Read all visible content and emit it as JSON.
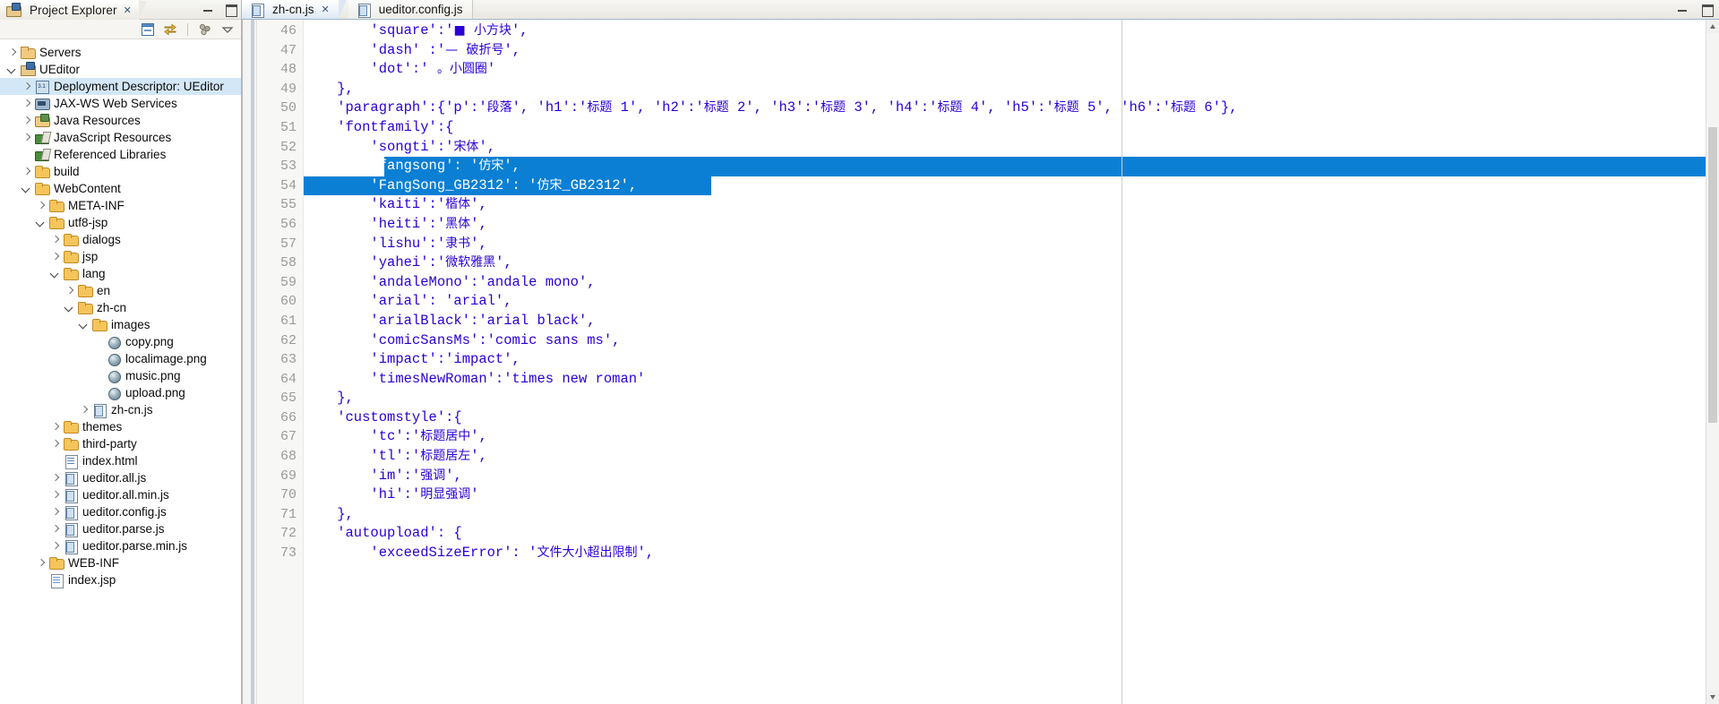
{
  "window": {
    "minimize_label": "Minimize",
    "maximize_label": "Maximize"
  },
  "project_explorer": {
    "tab_title": "Project Explorer",
    "tab_close": "✕",
    "toolbar": [
      {
        "name": "collapse-all-icon",
        "label": "Collapse All"
      },
      {
        "name": "link-with-editor-icon",
        "label": "Link with Editor"
      },
      {
        "name": "view-menu-icon",
        "label": "View Menu"
      },
      {
        "name": "minimize-view-icon",
        "label": "Minimize"
      }
    ],
    "tree": [
      {
        "label": "Servers",
        "indent": 0,
        "twisty": "closed",
        "icon": "ic-server",
        "selected": false
      },
      {
        "label": "UEditor",
        "indent": 0,
        "twisty": "open",
        "icon": "ic-project",
        "selected": false
      },
      {
        "label": "Deployment Descriptor: UEditor",
        "indent": 1,
        "twisty": "closed",
        "icon": "ic-dd",
        "selected": true
      },
      {
        "label": "JAX-WS Web Services",
        "indent": 1,
        "twisty": "closed",
        "icon": "ic-jax",
        "selected": false
      },
      {
        "label": "Java Resources",
        "indent": 1,
        "twisty": "closed",
        "icon": "ic-java",
        "selected": false
      },
      {
        "label": "JavaScript Resources",
        "indent": 1,
        "twisty": "closed",
        "icon": "ic-jslib",
        "selected": false
      },
      {
        "label": "Referenced Libraries",
        "indent": 1,
        "twisty": "none",
        "icon": "ic-jslib",
        "selected": false
      },
      {
        "label": "build",
        "indent": 1,
        "twisty": "closed",
        "icon": "ic-folder",
        "selected": false
      },
      {
        "label": "WebContent",
        "indent": 1,
        "twisty": "open",
        "icon": "ic-folder",
        "selected": false
      },
      {
        "label": "META-INF",
        "indent": 2,
        "twisty": "closed",
        "icon": "ic-folder",
        "selected": false
      },
      {
        "label": "utf8-jsp",
        "indent": 2,
        "twisty": "open",
        "icon": "ic-folder",
        "selected": false
      },
      {
        "label": "dialogs",
        "indent": 3,
        "twisty": "closed",
        "icon": "ic-folder",
        "selected": false
      },
      {
        "label": "jsp",
        "indent": 3,
        "twisty": "closed",
        "icon": "ic-folder",
        "selected": false
      },
      {
        "label": "lang",
        "indent": 3,
        "twisty": "open",
        "icon": "ic-folder",
        "selected": false
      },
      {
        "label": "en",
        "indent": 4,
        "twisty": "closed",
        "icon": "ic-folder",
        "selected": false
      },
      {
        "label": "zh-cn",
        "indent": 4,
        "twisty": "open",
        "icon": "ic-folder",
        "selected": false
      },
      {
        "label": "images",
        "indent": 5,
        "twisty": "open",
        "icon": "ic-folder",
        "selected": false
      },
      {
        "label": "copy.png",
        "indent": 6,
        "twisty": "none",
        "icon": "ic-png",
        "selected": false
      },
      {
        "label": "localimage.png",
        "indent": 6,
        "twisty": "none",
        "icon": "ic-png",
        "selected": false
      },
      {
        "label": "music.png",
        "indent": 6,
        "twisty": "none",
        "icon": "ic-png",
        "selected": false
      },
      {
        "label": "upload.png",
        "indent": 6,
        "twisty": "none",
        "icon": "ic-png",
        "selected": false
      },
      {
        "label": "zh-cn.js",
        "indent": 5,
        "twisty": "closed",
        "icon": "ic-js",
        "selected": false
      },
      {
        "label": "themes",
        "indent": 3,
        "twisty": "closed",
        "icon": "ic-folder",
        "selected": false
      },
      {
        "label": "third-party",
        "indent": 3,
        "twisty": "closed",
        "icon": "ic-folder",
        "selected": false
      },
      {
        "label": "index.html",
        "indent": 3,
        "twisty": "none",
        "icon": "ic-html",
        "selected": false
      },
      {
        "label": "ueditor.all.js",
        "indent": 3,
        "twisty": "closed",
        "icon": "ic-js",
        "selected": false
      },
      {
        "label": "ueditor.all.min.js",
        "indent": 3,
        "twisty": "closed",
        "icon": "ic-js",
        "selected": false
      },
      {
        "label": "ueditor.config.js",
        "indent": 3,
        "twisty": "closed",
        "icon": "ic-js",
        "selected": false
      },
      {
        "label": "ueditor.parse.js",
        "indent": 3,
        "twisty": "closed",
        "icon": "ic-js",
        "selected": false
      },
      {
        "label": "ueditor.parse.min.js",
        "indent": 3,
        "twisty": "closed",
        "icon": "ic-js",
        "selected": false
      },
      {
        "label": "WEB-INF",
        "indent": 2,
        "twisty": "closed",
        "icon": "ic-folder",
        "selected": false
      },
      {
        "label": "index.jsp",
        "indent": 2,
        "twisty": "none",
        "icon": "ic-jsp",
        "selected": false
      }
    ]
  },
  "editor": {
    "tabs": [
      {
        "label": "zh-cn.js",
        "active": true,
        "icon": "js-file-icon",
        "close": "✕"
      },
      {
        "label": "ueditor.config.js",
        "active": false,
        "icon": "js-file-icon",
        "close": ""
      }
    ],
    "first_line_number": 46,
    "selection_color": "#0a7fd4",
    "string_color": "#2a00d6",
    "lines": [
      {
        "n": 46,
        "text": "        'square':'■ 小方块',"
      },
      {
        "n": 47,
        "text": "        'dash' :'— 破折号',"
      },
      {
        "n": 48,
        "text": "        'dot':' 。小圆圈'"
      },
      {
        "n": 49,
        "text": "    },"
      },
      {
        "n": 50,
        "text": "    'paragraph':{'p':'段落', 'h1':'标题 1', 'h2':'标题 2', 'h3':'标题 3', 'h4':'标题 4', 'h5':'标题 5', 'h6':'标题 6'},"
      },
      {
        "n": 51,
        "text": "    'fontfamily':{"
      },
      {
        "n": 52,
        "text": "        'songti':'宋体',"
      },
      {
        "n": 53,
        "text": "        'fangsong': '仿宋',",
        "selected": "partial"
      },
      {
        "n": 54,
        "text": "        'FangSong_GB2312': '仿宋_GB2312',",
        "selected": "full"
      },
      {
        "n": 55,
        "text": "        'kaiti':'楷体',"
      },
      {
        "n": 56,
        "text": "        'heiti':'黑体',"
      },
      {
        "n": 57,
        "text": "        'lishu':'隶书',"
      },
      {
        "n": 58,
        "text": "        'yahei':'微软雅黑',"
      },
      {
        "n": 59,
        "text": "        'andaleMono':'andale mono',"
      },
      {
        "n": 60,
        "text": "        'arial': 'arial',"
      },
      {
        "n": 61,
        "text": "        'arialBlack':'arial black',"
      },
      {
        "n": 62,
        "text": "        'comicSansMs':'comic sans ms',"
      },
      {
        "n": 63,
        "text": "        'impact':'impact',"
      },
      {
        "n": 64,
        "text": "        'timesNewRoman':'times new roman'"
      },
      {
        "n": 65,
        "text": "    },"
      },
      {
        "n": 66,
        "text": "    'customstyle':{"
      },
      {
        "n": 67,
        "text": "        'tc':'标题居中',"
      },
      {
        "n": 68,
        "text": "        'tl':'标题居左',"
      },
      {
        "n": 69,
        "text": "        'im':'强调',"
      },
      {
        "n": 70,
        "text": "        'hi':'明显强调'"
      },
      {
        "n": 71,
        "text": "    },"
      },
      {
        "n": 72,
        "text": "    'autoupload': {"
      },
      {
        "n": 73,
        "text": "        'exceedSizeError': '文件大小超出限制',"
      }
    ]
  }
}
